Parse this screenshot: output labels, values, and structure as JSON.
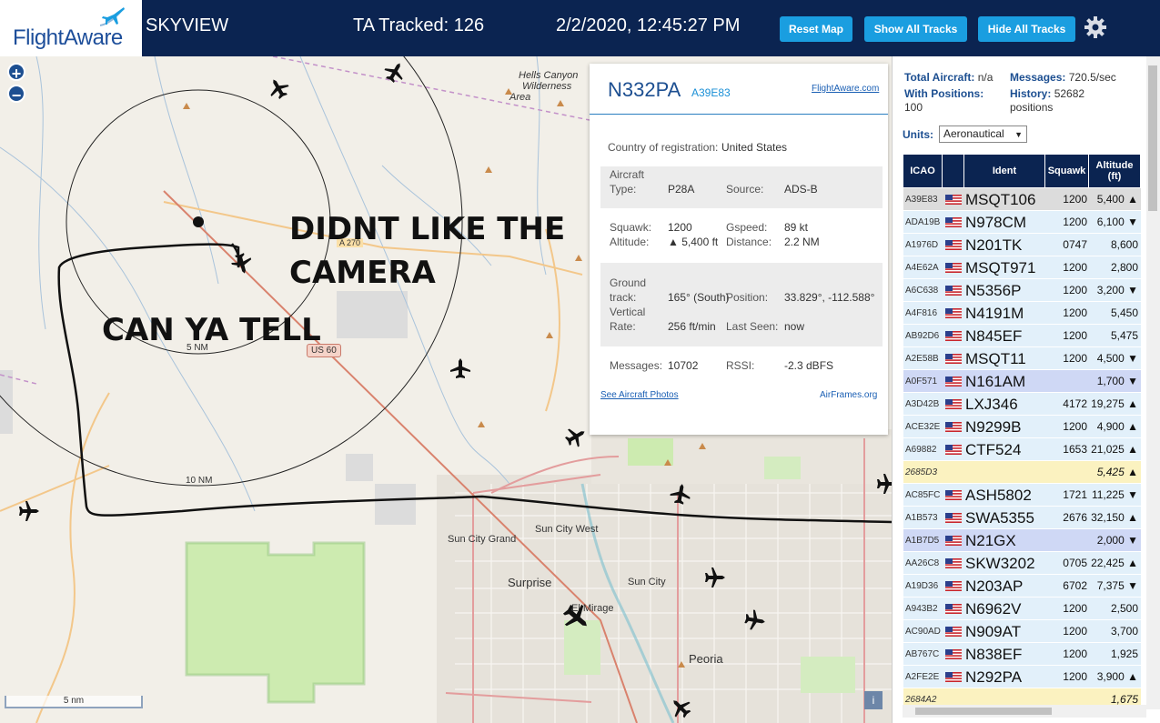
{
  "header": {
    "logo": "FlightAware",
    "app_name": "SKYVIEW",
    "tracked": "TA Tracked: 126",
    "datetime": "2/2/2020, 12:45:27 PM",
    "buttons": {
      "reset_map": "Reset Map",
      "show_all": "Show All Tracks",
      "hide_all": "Hide All Tracks"
    }
  },
  "map": {
    "zoom_in": "+",
    "zoom_out": "−",
    "annotations": {
      "line1": "DIDNT LIKE THE",
      "line2": "CAMERA",
      "line3": "CAN YA TELL"
    },
    "labels": {
      "hells_canyon_1": "Hells Canyon",
      "hells_canyon_2": "Wilderness",
      "hells_canyon_3": "Area",
      "ring_5nm": "5 NM",
      "ring_10nm": "10 NM",
      "us60": "US 60",
      "sun_city_west": "Sun City West",
      "sun_city_grand": "Sun City Grand",
      "surprise": "Surprise",
      "sun_city": "Sun City",
      "el_mirage": "El Mirage",
      "peoria": "Peoria",
      "a270": "A 270"
    },
    "scale": "5 nm",
    "info_icon": "i"
  },
  "popup": {
    "registration": "N332PA",
    "icao": "A39E83",
    "fa_link": "FlightAware.com",
    "country_label": "Country of registration:",
    "country": "United States",
    "aircraft_type_label_1": "Aircraft",
    "aircraft_type_label_2": "Type:",
    "aircraft_type": "P28A",
    "source_label": "Source:",
    "source": "ADS-B",
    "squawk_label": "Squawk:",
    "squawk": "1200",
    "gspeed_label": "Gspeed:",
    "gspeed": "89 kt",
    "altitude_label": "Altitude:",
    "altitude": "▲ 5,400 ft",
    "distance_label": "Distance:",
    "distance": "2.2 NM",
    "track_label_1": "Ground",
    "track_label_2": "track:",
    "track": "165° (South)",
    "position_label": "Position:",
    "position": "33.829°, -112.588°",
    "vrate_label_1": "Vertical",
    "vrate_label_2": "Rate:",
    "vrate": "256 ft/min",
    "last_seen_label": "Last Seen:",
    "last_seen": "now",
    "messages_label": "Messages:",
    "messages": "10702",
    "rssi_label": "RSSI:",
    "rssi": "-2.3 dBFS",
    "photos_link": "See Aircraft Photos",
    "airframes_link": "AirFrames.org"
  },
  "panel": {
    "total_label": "Total Aircraft:",
    "total_value": "n/a",
    "messages_label": "Messages:",
    "messages_value": "720.5/sec",
    "positions_label": "With Positions:",
    "positions_value": "100",
    "history_label": "History:",
    "history_value": "52682",
    "history_unit": "positions",
    "units_label": "Units:",
    "units_value": "Aeronautical",
    "columns": [
      "ICAO",
      "",
      "Ident",
      "Squawk",
      "Altitude (ft)"
    ],
    "rows": [
      {
        "icao": "A39E83",
        "flag": true,
        "ident": "MSQT106",
        "squawk": "1200",
        "alt": "5,400 ▲",
        "style": "selected"
      },
      {
        "icao": "ADA19B",
        "flag": true,
        "ident": "N978CM",
        "squawk": "1200",
        "alt": "6,100 ▼",
        "style": "normal"
      },
      {
        "icao": "A1976D",
        "flag": true,
        "ident": "N201TK",
        "squawk": "0747",
        "alt": "8,600",
        "style": "normal"
      },
      {
        "icao": "A4E62A",
        "flag": true,
        "ident": "MSQT971",
        "squawk": "1200",
        "alt": "2,800",
        "style": "normal"
      },
      {
        "icao": "A6C638",
        "flag": true,
        "ident": "N5356P",
        "squawk": "1200",
        "alt": "3,200 ▼",
        "style": "normal"
      },
      {
        "icao": "A4F816",
        "flag": true,
        "ident": "N4191M",
        "squawk": "1200",
        "alt": "5,450",
        "style": "normal"
      },
      {
        "icao": "AB92D6",
        "flag": true,
        "ident": "N845EF",
        "squawk": "1200",
        "alt": "5,475",
        "style": "normal"
      },
      {
        "icao": "A2E58B",
        "flag": true,
        "ident": "MSQT11",
        "squawk": "1200",
        "alt": "4,500 ▼",
        "style": "normal"
      },
      {
        "icao": "A0F571",
        "flag": true,
        "ident": "N161AM",
        "squawk": "",
        "alt": "1,700 ▼",
        "style": "mlat"
      },
      {
        "icao": "A3D42B",
        "flag": true,
        "ident": "LXJ346",
        "squawk": "4172",
        "alt": "19,275 ▲",
        "style": "normal"
      },
      {
        "icao": "ACE32E",
        "flag": true,
        "ident": "N9299B",
        "squawk": "1200",
        "alt": "4,900 ▲",
        "style": "normal"
      },
      {
        "icao": "A69882",
        "flag": true,
        "ident": "CTF524",
        "squawk": "1653",
        "alt": "21,025 ▲",
        "style": "normal"
      },
      {
        "icao": "2685D3",
        "flag": false,
        "ident": "",
        "squawk": "",
        "alt": "5,425 ▲",
        "style": "tisb"
      },
      {
        "icao": "AC85FC",
        "flag": true,
        "ident": "ASH5802",
        "squawk": "1721",
        "alt": "11,225 ▼",
        "style": "normal"
      },
      {
        "icao": "A1B573",
        "flag": true,
        "ident": "SWA5355",
        "squawk": "2676",
        "alt": "32,150 ▲",
        "style": "normal"
      },
      {
        "icao": "A1B7D5",
        "flag": true,
        "ident": "N21GX",
        "squawk": "",
        "alt": "2,000 ▼",
        "style": "mlat"
      },
      {
        "icao": "AA26C8",
        "flag": true,
        "ident": "SKW3202",
        "squawk": "0705",
        "alt": "22,425 ▲",
        "style": "normal"
      },
      {
        "icao": "A19D36",
        "flag": true,
        "ident": "N203AP",
        "squawk": "6702",
        "alt": "7,375 ▼",
        "style": "normal"
      },
      {
        "icao": "A943B2",
        "flag": true,
        "ident": "N6962V",
        "squawk": "1200",
        "alt": "2,500",
        "style": "normal"
      },
      {
        "icao": "AC90AD",
        "flag": true,
        "ident": "N909AT",
        "squawk": "1200",
        "alt": "3,700",
        "style": "normal"
      },
      {
        "icao": "AB767C",
        "flag": true,
        "ident": "N838EF",
        "squawk": "1200",
        "alt": "1,925",
        "style": "normal"
      },
      {
        "icao": "A2FE2E",
        "flag": true,
        "ident": "N292PA",
        "squawk": "1200",
        "alt": "3,900 ▲",
        "style": "normal"
      },
      {
        "icao": "2684A2",
        "flag": false,
        "ident": "",
        "squawk": "",
        "alt": "1,675",
        "style": "tisb"
      }
    ]
  },
  "colors": {
    "header_bg": "#0b2451",
    "button": "#1a9ee0",
    "row_normal": "#e2f0fa",
    "row_selected": "#dcdcdc",
    "row_mlat": "#cfd8f5",
    "row_tisb": "#fbf2c0"
  }
}
